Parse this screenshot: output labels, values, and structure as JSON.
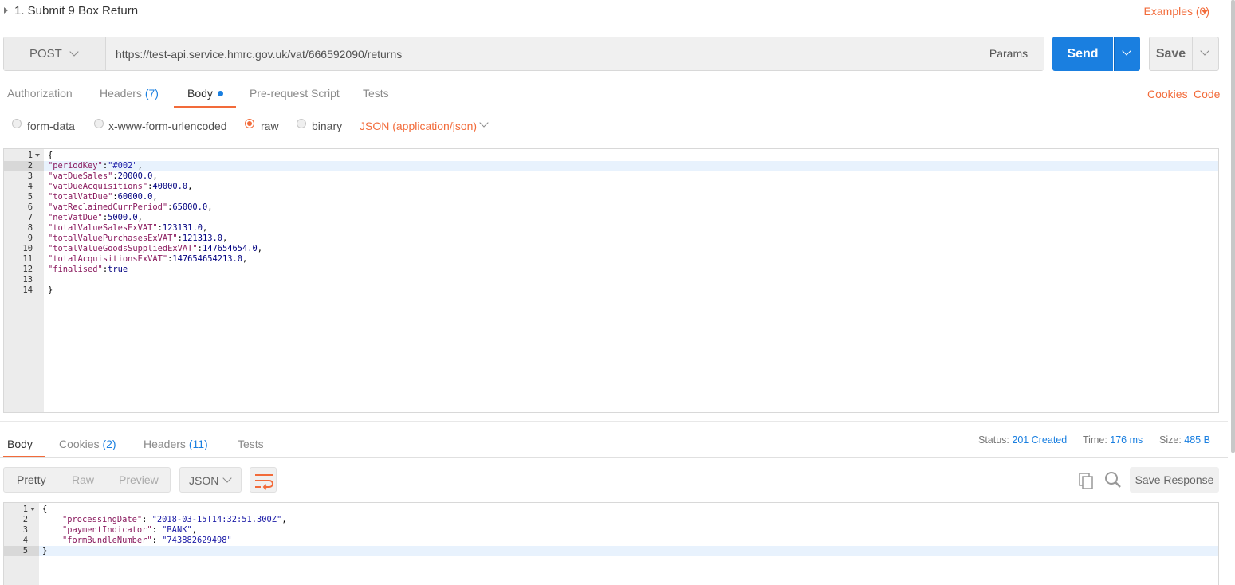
{
  "title": {
    "text": "1. Submit 9 Box Return",
    "examples": "Examples (0)"
  },
  "request": {
    "method": "POST",
    "url": "https://test-api.service.hmrc.gov.uk/vat/666592090/returns",
    "params_label": "Params",
    "send_label": "Send",
    "save_label": "Save"
  },
  "request_tabs": [
    {
      "label": "Authorization",
      "count": ""
    },
    {
      "label": "Headers",
      "count": "(7)"
    },
    {
      "label": "Body",
      "count": ""
    },
    {
      "label": "Pre-request Script",
      "count": ""
    },
    {
      "label": "Tests",
      "count": ""
    }
  ],
  "request_links": {
    "cookies": "Cookies",
    "code": "Code"
  },
  "body_modes": [
    "form-data",
    "x-www-form-urlencoded",
    "raw",
    "binary"
  ],
  "body_mode_selected": "raw",
  "content_type": "JSON (application/json)",
  "request_body_lines": [
    "{",
    "\"periodKey\":\"#002\",",
    "\"vatDueSales\":20000.0,",
    "\"vatDueAcquisitions\":40000.0,",
    "\"totalVatDue\":60000.0,",
    "\"vatReclaimedCurrPeriod\":65000.0,",
    "\"netVatDue\":5000.0,",
    "\"totalValueSalesExVAT\":123131.0,",
    "\"totalValuePurchasesExVAT\":121313.0,",
    "\"totalValueGoodsSuppliedExVAT\":147654654.0,",
    "\"totalAcquisitionsExVAT\":147654654213.0,",
    "\"finalised\":true",
    "",
    "}"
  ],
  "response_tabs": [
    {
      "label": "Body",
      "count": ""
    },
    {
      "label": "Cookies",
      "count": "(2)"
    },
    {
      "label": "Headers",
      "count": "(11)"
    },
    {
      "label": "Tests",
      "count": ""
    }
  ],
  "response_status": {
    "status_label": "Status:",
    "status_value": "201 Created",
    "time_label": "Time:",
    "time_value": "176 ms",
    "size_label": "Size:",
    "size_value": "485 B"
  },
  "response_views": [
    "Pretty",
    "Raw",
    "Preview"
  ],
  "response_format": "JSON",
  "save_response_label": "Save Response",
  "response_body_lines": [
    "{",
    "    \"processingDate\": \"2018-03-15T14:32:51.300Z\",",
    "    \"paymentIndicator\": \"BANK\",",
    "    \"formBundleNumber\": \"743882629498\"",
    "}"
  ],
  "colors": {
    "accent": "#f26b3a",
    "primary": "#1a7fe0"
  },
  "icons": [
    "caret-right-icon",
    "caret-down-icon",
    "chevron-down-icon",
    "wrap-lines-icon",
    "copy-icon",
    "search-icon"
  ]
}
